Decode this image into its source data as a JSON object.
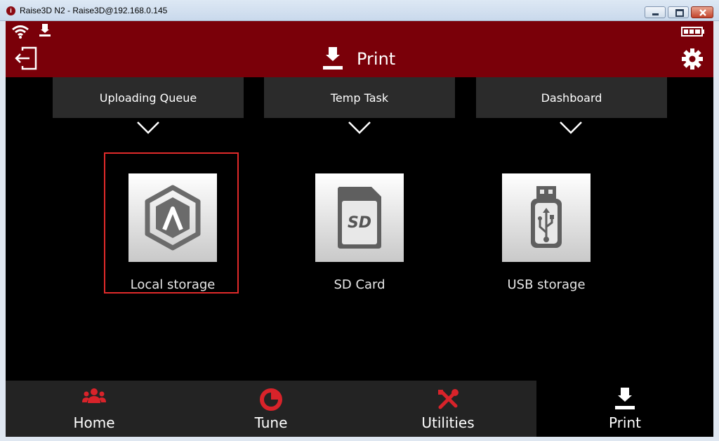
{
  "window": {
    "title": "Raise3D N2 - Raise3D@192.168.0.145",
    "app_icon_glyph": "i"
  },
  "header": {
    "title": "Print",
    "icons": [
      "wifi-icon",
      "upload-status-icon",
      "battery-icon",
      "exit-icon",
      "print-head-icon",
      "gear-icon"
    ]
  },
  "tabs": [
    {
      "label": "Uploading Queue"
    },
    {
      "label": "Temp Task"
    },
    {
      "label": "Dashboard"
    }
  ],
  "storage": [
    {
      "label": "Local storage",
      "icon": "raise3d-logo-icon",
      "selected": true
    },
    {
      "label": "SD Card",
      "icon": "sd-card-icon",
      "glyph": "SD"
    },
    {
      "label": "USB storage",
      "icon": "usb-stick-icon"
    }
  ],
  "nav": [
    {
      "label": "Home",
      "icon": "users-icon",
      "active": false
    },
    {
      "label": "Tune",
      "icon": "pie-chart-icon",
      "active": false
    },
    {
      "label": "Utilities",
      "icon": "tools-icon",
      "active": false
    },
    {
      "label": "Print",
      "icon": "print-head-icon",
      "active": true
    }
  ],
  "colors": {
    "brand": "#7a0009",
    "accent_red": "#d8232a",
    "highlight": "#e02a2a",
    "background": "#000000",
    "nav_bg": "#232323"
  }
}
